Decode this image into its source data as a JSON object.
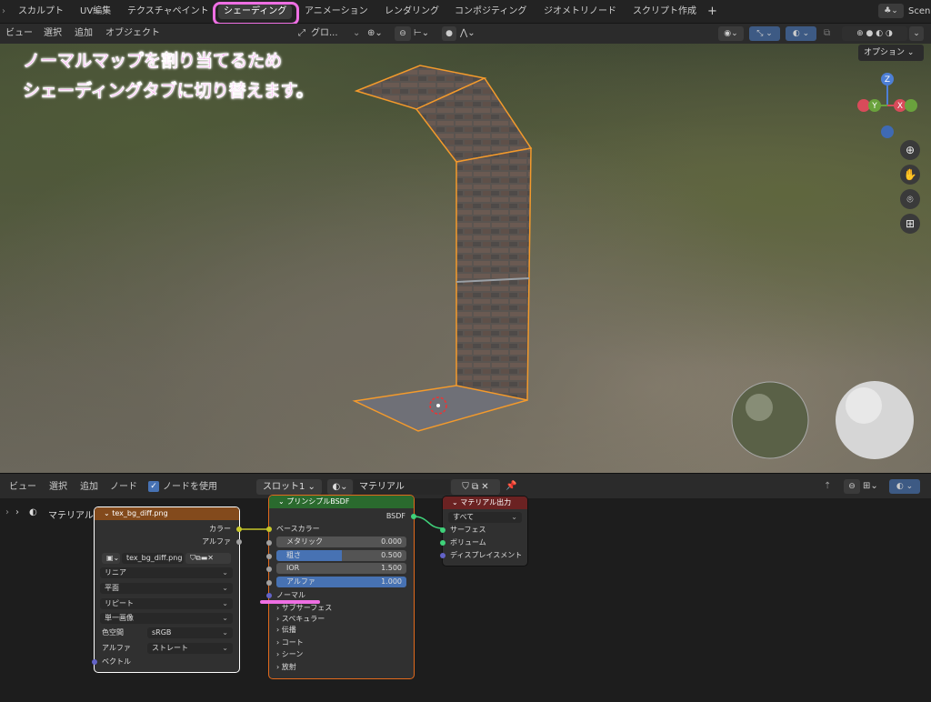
{
  "workspace_tabs": [
    "スカルプト",
    "UV編集",
    "テクスチャペイント",
    "シェーディング",
    "アニメーション",
    "レンダリング",
    "コンポジティング",
    "ジオメトリノード",
    "スクリプト作成"
  ],
  "active_tab": "シェーディング",
  "scene_label": "Scen",
  "viewport_menu": [
    "ビュー",
    "選択",
    "追加",
    "オブジェクト"
  ],
  "transform_orientation": "グロ...",
  "options_label": "オプション",
  "annotation": {
    "line1": "ノーマルマップを割り当てるため",
    "line2": "シェーディングタブに切り替えます。"
  },
  "gizmo": {
    "z": "Z",
    "y": "Y",
    "x": "X"
  },
  "node_menu": [
    "ビュー",
    "選択",
    "追加",
    "ノード"
  ],
  "use_nodes_label": "ノードを使用",
  "slot_label": "スロット1",
  "material_name": "マテリアル",
  "breadcrumb_label": "マテリアル",
  "image_node": {
    "title": "tex_bg_diff.png",
    "out_color": "カラー",
    "out_alpha": "アルファ",
    "image_name": "tex_bg_diff.png",
    "interpolation": "リニア",
    "projection": "平面",
    "extension": "リピート",
    "source": "単一画像",
    "colorspace_label": "色空間",
    "colorspace": "sRGB",
    "alpha_label": "アルファ",
    "alpha_mode": "ストレート",
    "vector_label": "ベクトル"
  },
  "bsdf_node": {
    "title": "プリンシプルBSDF",
    "out": "BSDF",
    "base_color": "ベースカラー",
    "fields": [
      {
        "label": "メタリック",
        "value": "0.000",
        "fill": 0.0
      },
      {
        "label": "粗さ",
        "value": "0.500",
        "fill": 0.5
      },
      {
        "label": "IOR",
        "value": "1.500",
        "fill": 0.0
      },
      {
        "label": "アルファ",
        "value": "1.000",
        "fill": 1.0
      }
    ],
    "normal": "ノーマル",
    "sections": [
      "サブサーフェス",
      "スペキュラー",
      "伝播",
      "コート",
      "シーン",
      "放射"
    ]
  },
  "output_node": {
    "title": "マテリアル出力",
    "target": "すべて",
    "inputs": [
      "サーフェス",
      "ボリューム",
      "ディスプレイスメント"
    ]
  },
  "colors": {
    "accent": "#ee6fe3",
    "selection": "#f39a2c",
    "image_header": "#834a1c",
    "bsdf_header": "#2a6a2e",
    "output_header": "#6b2222",
    "field_blue": "#4772b3"
  }
}
